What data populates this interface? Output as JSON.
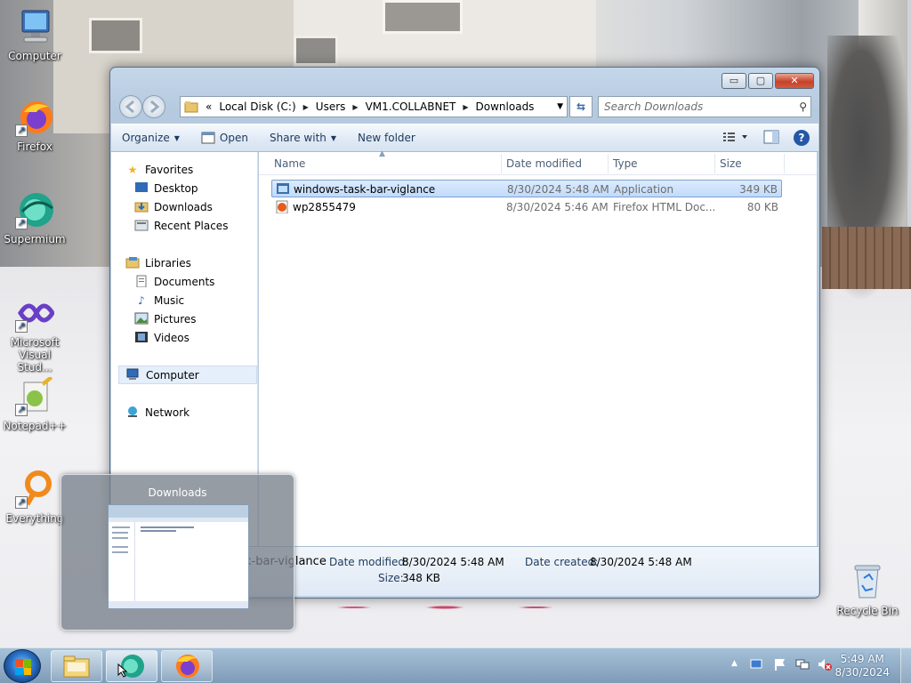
{
  "desktop_icons": [
    {
      "label": "Computer",
      "icon": "computer-icon"
    },
    {
      "label": "Firefox",
      "icon": "firefox-icon"
    },
    {
      "label": "Supermium",
      "icon": "supermium-icon"
    },
    {
      "label": "Microsoft Visual Stud...",
      "icon": "visual-studio-icon"
    },
    {
      "label": "Notepad++",
      "icon": "notepadpp-icon"
    },
    {
      "label": "Everything",
      "icon": "everything-icon"
    },
    {
      "label": "Recycle Bin",
      "icon": "recycle-bin-icon"
    }
  ],
  "explorer": {
    "title_buttons": {
      "minimize": "▭",
      "maximize": "▢",
      "close": "✕"
    },
    "address": {
      "overflow": "«",
      "crumbs": [
        "Local Disk (C:)",
        "Users",
        "VM1.COLLABNET",
        "Downloads"
      ]
    },
    "search_placeholder": "Search Downloads",
    "toolbar": {
      "organize": "Organize",
      "open": "Open",
      "share_with": "Share with",
      "new_folder": "New folder"
    },
    "nav": {
      "favorites": "Favorites",
      "desktop": "Desktop",
      "downloads": "Downloads",
      "recent_places": "Recent Places",
      "libraries": "Libraries",
      "documents": "Documents",
      "music": "Music",
      "pictures": "Pictures",
      "videos": "Videos",
      "computer": "Computer",
      "network": "Network"
    },
    "columns": {
      "name": "Name",
      "date_modified": "Date modified",
      "type": "Type",
      "size": "Size"
    },
    "files": [
      {
        "name": "windows-task-bar-viglance",
        "date": "8/30/2024 5:48 AM",
        "type": "Application",
        "size": "349 KB"
      },
      {
        "name": "wp2855479",
        "date": "8/30/2024 5:46 AM",
        "type": "Firefox HTML Doc...",
        "size": "80 KB"
      }
    ],
    "details": {
      "name_partial": "k-bar-viglance",
      "date_modified_label": "Date modified:",
      "date_modified": "8/30/2024 5:48 AM",
      "date_created_label": "Date created:",
      "date_created": "8/30/2024 5:48 AM",
      "size_label": "Size:",
      "size": "348 KB"
    }
  },
  "thumbnail": {
    "title": "Downloads"
  },
  "taskbar": {
    "clock_time": "5:49 AM",
    "clock_date": "8/30/2024"
  }
}
